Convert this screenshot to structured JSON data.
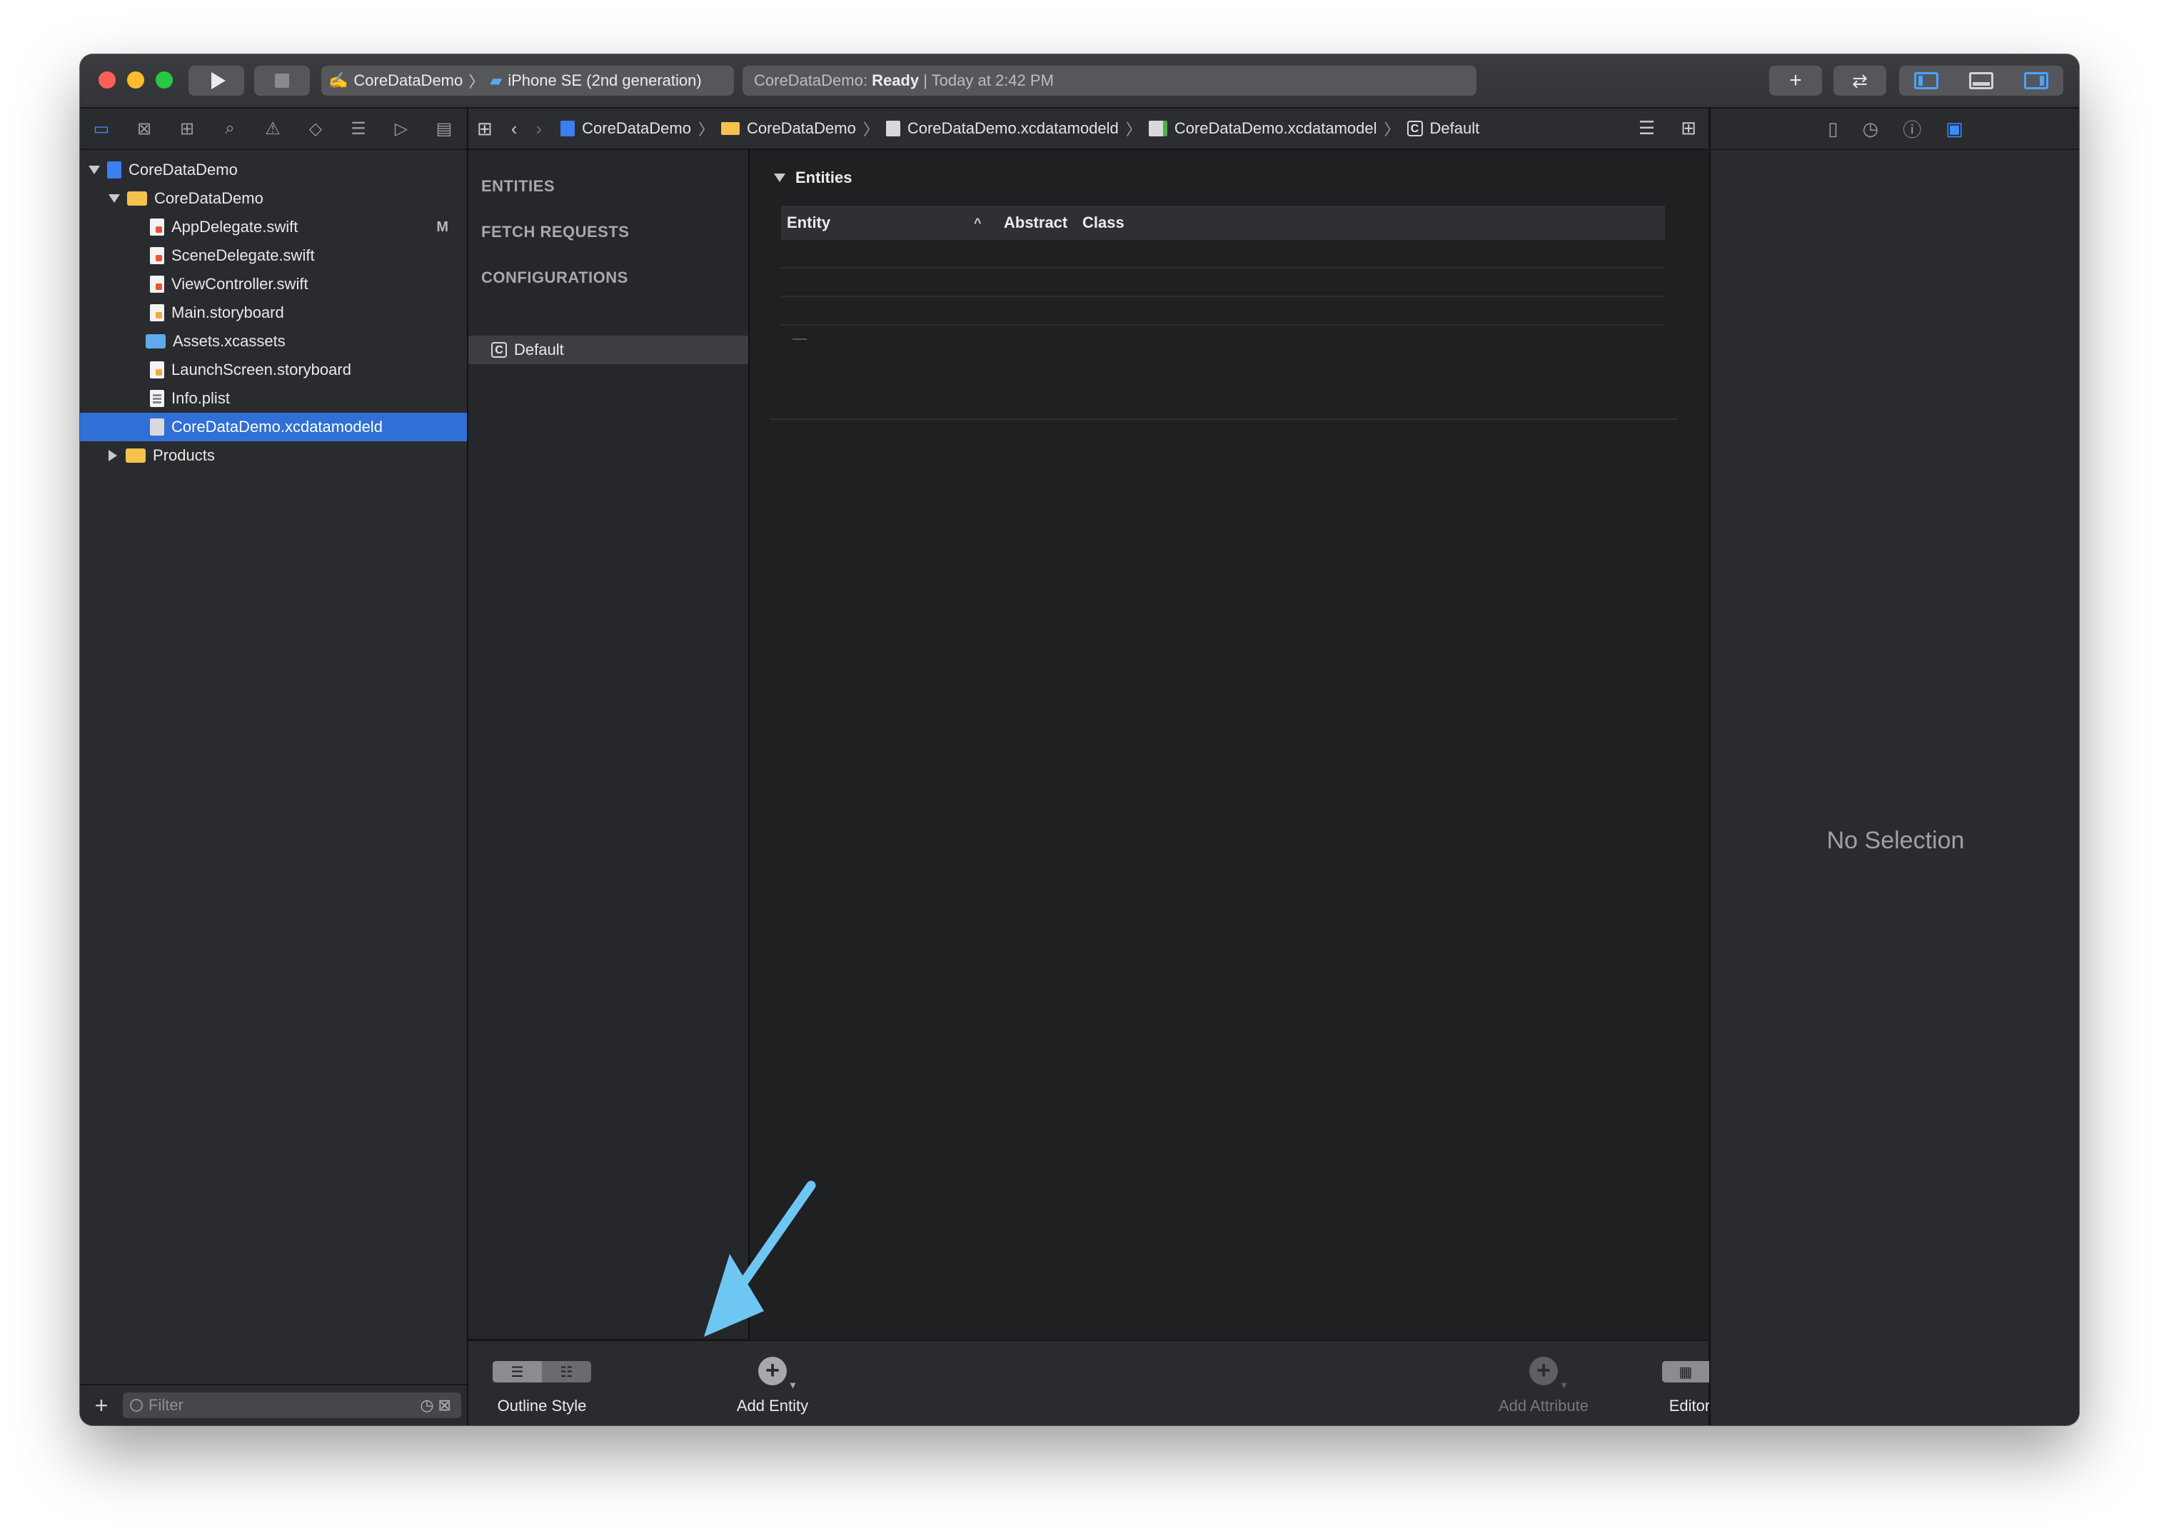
{
  "scheme": {
    "target": "CoreDataDemo",
    "device": "iPhone SE (2nd generation)"
  },
  "status": {
    "project": "CoreDataDemo:",
    "state": "Ready",
    "time": "| Today at 2:42 PM"
  },
  "navigator": {
    "tree": [
      {
        "label": "CoreDataDemo",
        "icon": "project-icon"
      },
      {
        "label": "CoreDataDemo",
        "icon": "folder-icon"
      },
      {
        "label": "AppDelegate.swift",
        "icon": "swift-file-icon",
        "badge": "M"
      },
      {
        "label": "SceneDelegate.swift",
        "icon": "swift-file-icon"
      },
      {
        "label": "ViewController.swift",
        "icon": "swift-file-icon"
      },
      {
        "label": "Main.storyboard",
        "icon": "storyboard-icon"
      },
      {
        "label": "Assets.xcassets",
        "icon": "assets-folder-icon"
      },
      {
        "label": "LaunchScreen.storyboard",
        "icon": "storyboard-icon"
      },
      {
        "label": "Info.plist",
        "icon": "plist-icon"
      },
      {
        "label": "CoreDataDemo.xcdatamodeld",
        "icon": "data-model-icon"
      },
      {
        "label": "Products",
        "icon": "folder-icon"
      }
    ],
    "filter_placeholder": "Filter"
  },
  "jumpbar": {
    "crumbs": [
      "CoreDataDemo",
      "CoreDataDemo",
      "CoreDataDemo.xcdatamodeld",
      "CoreDataDemo.xcdatamodel",
      "Default"
    ]
  },
  "model_sidebar": {
    "entities": "ENTITIES",
    "fetch_requests": "FETCH REQUESTS",
    "configurations": "CONFIGURATIONS",
    "default_config": "Default",
    "config_badge": "C"
  },
  "entities": {
    "section_title": "Entities",
    "columns": [
      "Entity",
      "Abstract",
      "Class"
    ]
  },
  "bottombar": {
    "outline_style": "Outline Style",
    "add_entity": "Add Entity",
    "add_attribute": "Add Attribute",
    "editor_style": "Editor Style"
  },
  "inspector": {
    "empty": "No Selection"
  },
  "colors": {
    "accent": "#3a8dff",
    "selection": "#2f6fd6",
    "annotation_arrow": "#6ec6f2"
  }
}
